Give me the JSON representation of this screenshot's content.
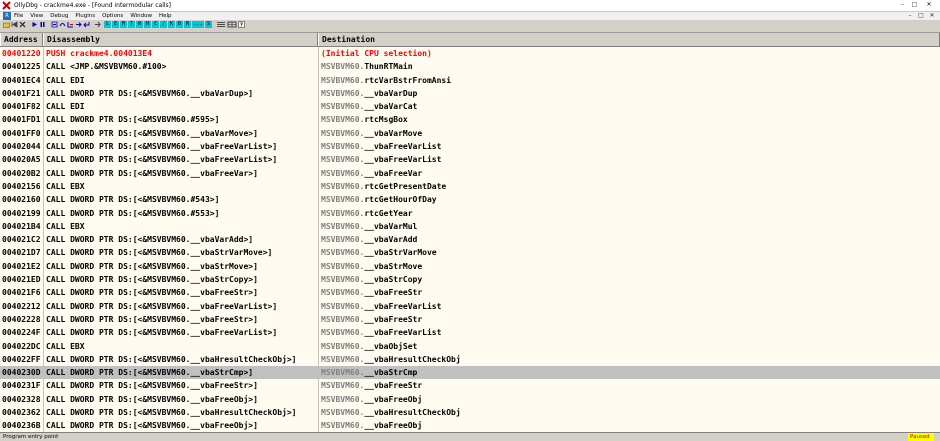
{
  "window": {
    "title": "OllyDbg - crackme4.exe - [Found intermodular calls]",
    "minimize": "–",
    "maximize": "□",
    "close": "✕"
  },
  "menu": {
    "mdi_icon_label": "R",
    "items": [
      "File",
      "View",
      "Debug",
      "Plugins",
      "Options",
      "Window",
      "Help"
    ]
  },
  "toolbar": {
    "letters": [
      "L",
      "E",
      "M",
      "T",
      "W",
      "H",
      "C",
      "/",
      "K",
      "B",
      "R",
      "...",
      "S"
    ]
  },
  "columns": {
    "address": "Address",
    "disassembly": "Disassembly",
    "destination": "Destination"
  },
  "rows": [
    {
      "address": "00401220",
      "disassembly": "PUSH crackme4.004013E4",
      "module": "",
      "func": "(Initial CPU selection)"
    },
    {
      "address": "00401225",
      "disassembly": "CALL <JMP.&MSVBVM60.#100>",
      "module": "MSVBVM60.",
      "func": "ThunRTMain"
    },
    {
      "address": "00401EC4",
      "disassembly": "CALL EDI",
      "module": "MSVBVM60.",
      "func": "rtcVarBstrFromAnsi"
    },
    {
      "address": "00401F21",
      "disassembly": "CALL DWORD PTR DS:[<&MSVBVM60.__vbaVarDup>]",
      "module": "MSVBVM60.",
      "func": "__vbaVarDup"
    },
    {
      "address": "00401F82",
      "disassembly": "CALL EDI",
      "module": "MSVBVM60.",
      "func": "__vbaVarCat"
    },
    {
      "address": "00401FD1",
      "disassembly": "CALL DWORD PTR DS:[<&MSVBVM60.#595>]",
      "module": "MSVBVM60.",
      "func": "rtcMsgBox"
    },
    {
      "address": "00401FF0",
      "disassembly": "CALL DWORD PTR DS:[<&MSVBVM60.__vbaVarMove>]",
      "module": "MSVBVM60.",
      "func": "__vbaVarMove"
    },
    {
      "address": "00402044",
      "disassembly": "CALL DWORD PTR DS:[<&MSVBVM60.__vbaFreeVarList>]",
      "module": "MSVBVM60.",
      "func": "__vbaFreeVarList"
    },
    {
      "address": "004020A5",
      "disassembly": "CALL DWORD PTR DS:[<&MSVBVM60.__vbaFreeVarList>]",
      "module": "MSVBVM60.",
      "func": "__vbaFreeVarList"
    },
    {
      "address": "004020B2",
      "disassembly": "CALL DWORD PTR DS:[<&MSVBVM60.__vbaFreeVar>]",
      "module": "MSVBVM60.",
      "func": "__vbaFreeVar"
    },
    {
      "address": "00402156",
      "disassembly": "CALL EBX",
      "module": "MSVBVM60.",
      "func": "rtcGetPresentDate"
    },
    {
      "address": "00402160",
      "disassembly": "CALL DWORD PTR DS:[<&MSVBVM60.#543>]",
      "module": "MSVBVM60.",
      "func": "rtcGetHourOfDay"
    },
    {
      "address": "00402199",
      "disassembly": "CALL DWORD PTR DS:[<&MSVBVM60.#553>]",
      "module": "MSVBVM60.",
      "func": "rtcGetYear"
    },
    {
      "address": "004021B4",
      "disassembly": "CALL EBX",
      "module": "MSVBVM60.",
      "func": "__vbaVarMul"
    },
    {
      "address": "004021C2",
      "disassembly": "CALL DWORD PTR DS:[<&MSVBVM60.__vbaVarAdd>]",
      "module": "MSVBVM60.",
      "func": "__vbaVarAdd"
    },
    {
      "address": "004021D7",
      "disassembly": "CALL DWORD PTR DS:[<&MSVBVM60.__vbaStrVarMove>]",
      "module": "MSVBVM60.",
      "func": "__vbaStrVarMove"
    },
    {
      "address": "004021E2",
      "disassembly": "CALL DWORD PTR DS:[<&MSVBVM60.__vbaStrMove>]",
      "module": "MSVBVM60.",
      "func": "__vbaStrMove"
    },
    {
      "address": "004021ED",
      "disassembly": "CALL DWORD PTR DS:[<&MSVBVM60.__vbaStrCopy>]",
      "module": "MSVBVM60.",
      "func": "__vbaStrCopy"
    },
    {
      "address": "004021F6",
      "disassembly": "CALL DWORD PTR DS:[<&MSVBVM60.__vbaFreeStr>]",
      "module": "MSVBVM60.",
      "func": "__vbaFreeStr"
    },
    {
      "address": "00402212",
      "disassembly": "CALL DWORD PTR DS:[<&MSVBVM60.__vbaFreeVarList>]",
      "module": "MSVBVM60.",
      "func": "__vbaFreeVarList"
    },
    {
      "address": "00402228",
      "disassembly": "CALL DWORD PTR DS:[<&MSVBVM60.__vbaFreeStr>]",
      "module": "MSVBVM60.",
      "func": "__vbaFreeStr"
    },
    {
      "address": "0040224F",
      "disassembly": "CALL DWORD PTR DS:[<&MSVBVM60.__vbaFreeVarList>]",
      "module": "MSVBVM60.",
      "func": "__vbaFreeVarList"
    },
    {
      "address": "004022DC",
      "disassembly": "CALL EBX",
      "module": "MSVBVM60.",
      "func": "__vbaObjSet"
    },
    {
      "address": "004022FF",
      "disassembly": "CALL DWORD PTR DS:[<&MSVBVM60.__vbaHresultCheckObj>]",
      "module": "MSVBVM60.",
      "func": "__vbaHresultCheckObj"
    },
    {
      "address": "0040230D",
      "disassembly": "CALL DWORD PTR DS:[<&MSVBVM60.__vbaStrCmp>]",
      "module": "MSVBVM60.",
      "func": "__vbaStrCmp"
    },
    {
      "address": "0040231F",
      "disassembly": "CALL DWORD PTR DS:[<&MSVBVM60.__vbaFreeStr>]",
      "module": "MSVBVM60.",
      "func": "__vbaFreeStr"
    },
    {
      "address": "00402328",
      "disassembly": "CALL DWORD PTR DS:[<&MSVBVM60.__vbaFreeObj>]",
      "module": "MSVBVM60.",
      "func": "__vbaFreeObj"
    },
    {
      "address": "00402362",
      "disassembly": "CALL DWORD PTR DS:[<&MSVBVM60.__vbaHresultCheckObj>]",
      "module": "MSVBVM60.",
      "func": "__vbaHresultCheckObj"
    },
    {
      "address": "0040236B",
      "disassembly": "CALL DWORD PTR DS:[<&MSVBVM60.__vbaFreeObj>]",
      "module": "MSVBVM60.",
      "func": "__vbaFreeObj"
    }
  ],
  "status": {
    "text": "Program entry point",
    "state": "Paused"
  },
  "colors": {
    "highlight_row": "#c0c0c0",
    "initial_selection": "#ff0000",
    "list_background": "#fffbf0",
    "paused_badge": "#ffff00"
  },
  "icons": [
    "ollydbg-app-icon",
    "open-icon",
    "restart-icon",
    "close-icon",
    "run-icon",
    "pause-icon",
    "step-into-icon",
    "step-over-icon",
    "trace-into-icon",
    "trace-over-icon",
    "execute-till-return-icon",
    "go-to-icon",
    "list-icon",
    "grid-icon",
    "help-icon"
  ]
}
